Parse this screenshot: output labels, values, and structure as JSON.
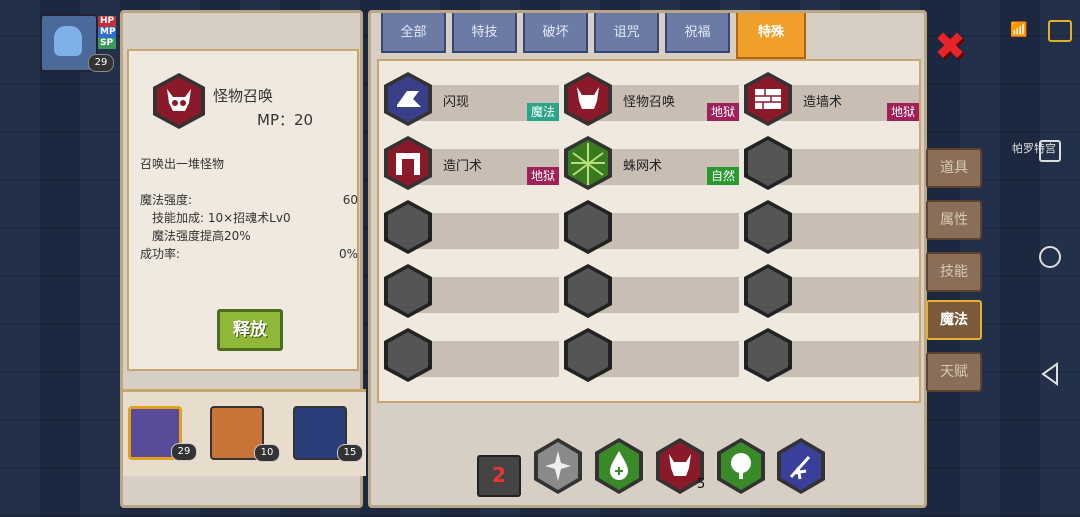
{
  "hud": {
    "bars": [
      "HP",
      "MP",
      "SP"
    ],
    "level": "29"
  },
  "detail": {
    "skill_name": "怪物召唤",
    "mp_text": "MP：20",
    "description": "召唤出一堆怪物",
    "stats": [
      {
        "label": "魔法强度:",
        "value": "60"
      },
      {
        "label": "技能加成: 10×招魂术Lv0",
        "value": ""
      },
      {
        "label": "魔法强度提高20%",
        "value": ""
      },
      {
        "label": "成功率:",
        "value": "0%"
      }
    ],
    "release_label": "释放"
  },
  "party": [
    {
      "level": "29"
    },
    {
      "level": "10"
    },
    {
      "level": "15"
    }
  ],
  "tabs": [
    "全部",
    "特技",
    "破坏",
    "诅咒",
    "祝福",
    "特殊"
  ],
  "active_tab": "特殊",
  "skills": [
    {
      "name": "闪现",
      "tag": "魔法",
      "tag_color": "#2aa58a",
      "icon": "dash-icon",
      "hex": "#3a3f8a"
    },
    {
      "name": "怪物召唤",
      "tag": "地狱",
      "tag_color": "#a0205a",
      "icon": "demon-skull-icon",
      "hex": "#8a1a2a"
    },
    {
      "name": "造墙术",
      "tag": "地狱",
      "tag_color": "#a0205a",
      "icon": "wall-icon",
      "hex": "#8a1a2a"
    },
    {
      "name": "造门术",
      "tag": "地狱",
      "tag_color": "#a0205a",
      "icon": "gate-icon",
      "hex": "#8a1a2a"
    },
    {
      "name": "蛛网术",
      "tag": "自然",
      "tag_color": "#2a9a30",
      "icon": "web-icon",
      "hex": "#3a7a20"
    }
  ],
  "quickbar": {
    "record_label": "2",
    "slots": [
      {
        "icon": "shuriken-icon",
        "count": ""
      },
      {
        "icon": "heal-drop-icon",
        "count": ""
      },
      {
        "icon": "demon-skull-icon",
        "count": "5"
      },
      {
        "icon": "tree-icon",
        "count": ""
      },
      {
        "icon": "magic-missile-icon",
        "count": ""
      }
    ]
  },
  "side_menu": [
    "道具",
    "属性",
    "技能",
    "魔法",
    "天赋"
  ],
  "active_side": "魔法",
  "location_text": "帕罗特宫"
}
